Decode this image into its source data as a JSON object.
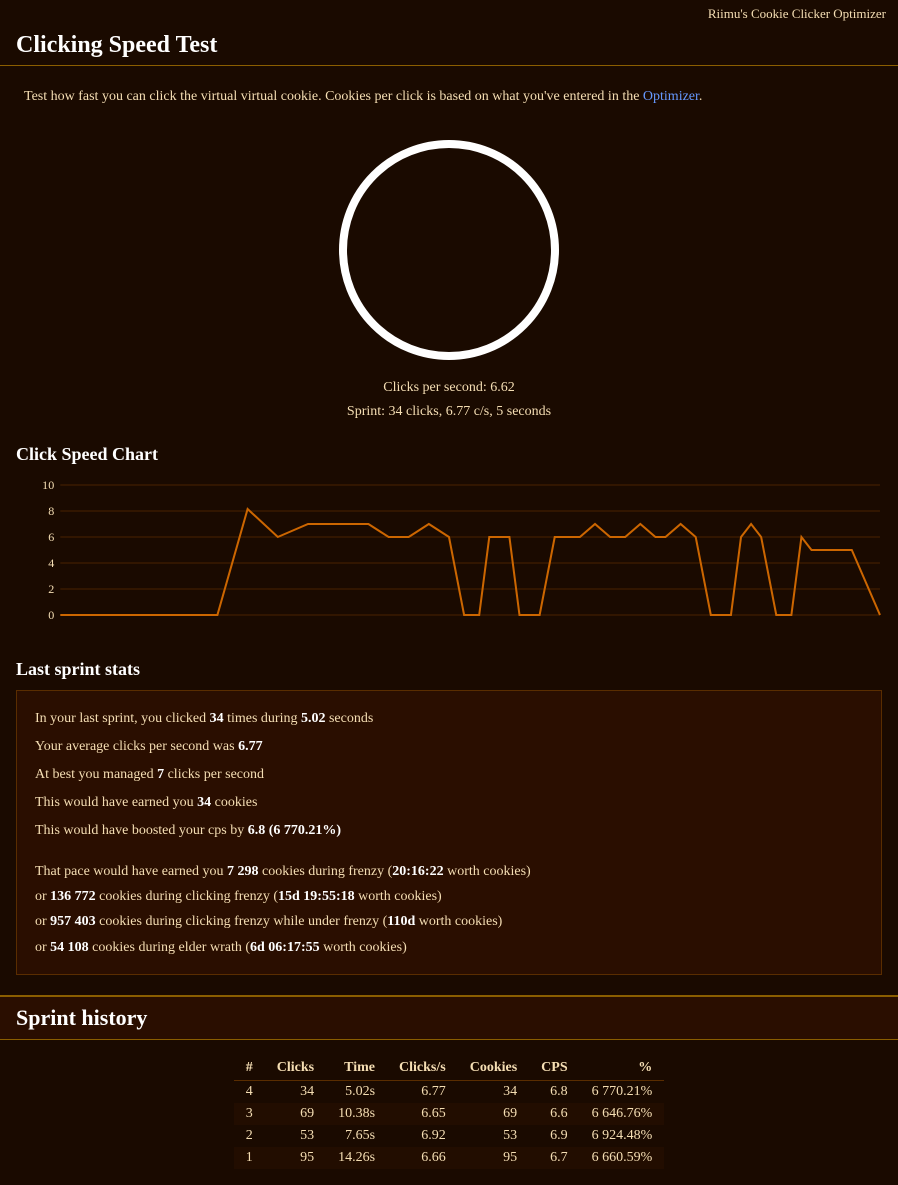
{
  "app": {
    "header": "Riimu's Cookie Clicker Optimizer",
    "title": "Clicking Speed Test"
  },
  "description": {
    "text": "Test how fast you can click the virtual virtual cookie. Cookies per click is based on what you've entered in the ",
    "link_label": "Optimizer",
    "text_end": "."
  },
  "cookie": {
    "cps_label": "Clicks per second: 6.62",
    "sprint_label": "Sprint: 34 clicks, 6.77 c/s, 5 seconds"
  },
  "chart": {
    "title": "Click Speed Chart",
    "y_labels": [
      "10",
      "8",
      "6",
      "4",
      "2",
      "0"
    ]
  },
  "last_sprint": {
    "title": "Last sprint stats",
    "stats": [
      "In your last sprint, you clicked 34 times during 5.02 seconds",
      "Your average clicks per second was 6.77",
      "At best you managed 7 clicks per second",
      "This would have earned you 34 cookies",
      "This would have boosted your cps by 6.8 (6 770.21%)"
    ],
    "frenzy": [
      "That pace would have earned you 7 298 cookies during frenzy (20:16:22 worth cookies)",
      "or 136 772 cookies during clicking frenzy (15d 19:55:18 worth cookies)",
      "or 957 403 cookies during clicking frenzy while under frenzy (110d worth cookies)",
      "or 54 108 cookies during elder wrath (6d 06:17:55 worth cookies)"
    ]
  },
  "sprint_history": {
    "title": "Sprint history",
    "columns": [
      "#",
      "Clicks",
      "Time",
      "Clicks/s",
      "Cookies",
      "CPS",
      "%"
    ],
    "rows": [
      {
        "num": "4",
        "clicks": "34",
        "time": "5.02s",
        "cps": "6.77",
        "cookies": "34",
        "cpsx": "6.8",
        "pct": "6 770.21%"
      },
      {
        "num": "3",
        "clicks": "69",
        "time": "10.38s",
        "cps": "6.65",
        "cookies": "69",
        "cpsx": "6.6",
        "pct": "6 646.76%"
      },
      {
        "num": "2",
        "clicks": "53",
        "time": "7.65s",
        "cps": "6.92",
        "cookies": "53",
        "cpsx": "6.9",
        "pct": "6 924.48%"
      },
      {
        "num": "1",
        "clicks": "95",
        "time": "14.26s",
        "cps": "6.66",
        "cookies": "95",
        "cpsx": "6.7",
        "pct": "6 660.59%"
      }
    ]
  }
}
